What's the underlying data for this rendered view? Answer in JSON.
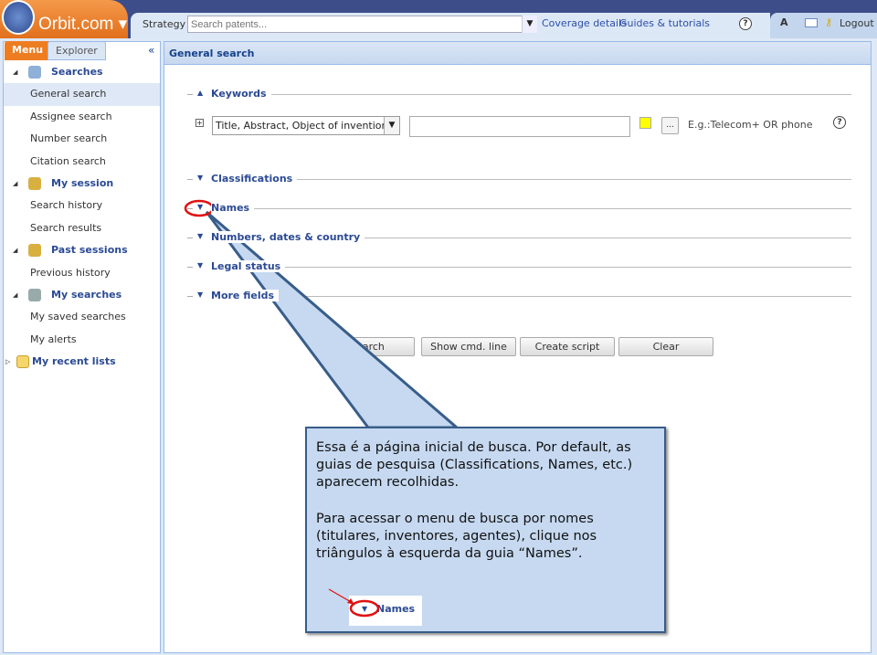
{
  "header": {
    "logo": "Orbit.com",
    "strategy_label": "Strategy :",
    "search_placeholder": "Search patents...",
    "links": [
      "Coverage details",
      "Guides & tutorials"
    ],
    "logout": "Logout"
  },
  "sidebar": {
    "tabs": [
      "Menu",
      "Explorer"
    ],
    "collapse": "«",
    "items": [
      {
        "label": "Searches",
        "type": "head"
      },
      {
        "label": "General search",
        "type": "item",
        "selected": true
      },
      {
        "label": "Assignee search",
        "type": "item"
      },
      {
        "label": "Number search",
        "type": "item"
      },
      {
        "label": "Citation search",
        "type": "item"
      },
      {
        "label": "My session",
        "type": "head"
      },
      {
        "label": "Search history",
        "type": "item"
      },
      {
        "label": "Search results",
        "type": "item"
      },
      {
        "label": "Past sessions",
        "type": "head"
      },
      {
        "label": "Previous history",
        "type": "item"
      },
      {
        "label": "My searches",
        "type": "head"
      },
      {
        "label": "My saved searches",
        "type": "item"
      },
      {
        "label": "My alerts",
        "type": "item"
      },
      {
        "label": "My recent lists",
        "type": "folder"
      }
    ]
  },
  "main": {
    "title": "General search",
    "sections": [
      "Keywords",
      "Classifications",
      "Names",
      "Numbers, dates & country",
      "Legal status",
      "More fields"
    ],
    "field_select": "Title, Abstract, Object of invention, A",
    "keyword_value": "",
    "dots": "...",
    "example": "E.g.:Telecom+ OR phone",
    "buttons": [
      "Search",
      "Show cmd. line",
      "Create script",
      "Clear"
    ]
  },
  "callout": {
    "p1": "Essa é a página inicial de busca. Por default, as guias de pesquisa (Classifications, Names, etc.) aparecem recolhidas.",
    "p2": "Para acessar o menu de busca por nomes (titulares, inventores, agentes), clique nos triângulos à esquerda  da guia “Names”.",
    "mini_label": "Names"
  },
  "colors": {
    "topbar": "#3d4d8a",
    "brand_orange": "#ee7d22",
    "link": "#2d4fa8",
    "callout_fill": "#c6d9f1",
    "callout_border": "#385d8a",
    "highlight": "#e01010"
  }
}
